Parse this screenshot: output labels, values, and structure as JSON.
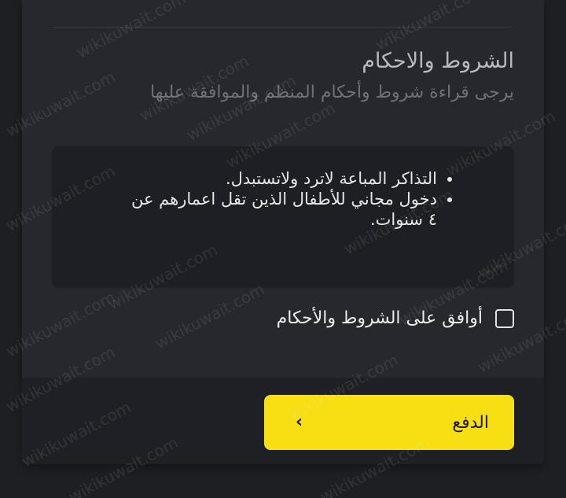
{
  "terms": {
    "title": "الشروط والاحكام",
    "subtitle": "يرجى قراءة شروط وأحكام المنظم والموافقة عليها",
    "items": [
      "التذاكر المباعة لاترد ولاتستبدل.",
      "دخول مجاني للأطفال الذين تقل اعمارهم عن ٤ سنوات."
    ]
  },
  "agreement": {
    "label": "أوافق على الشروط والأحكام",
    "checked": false
  },
  "footer": {
    "pay_label": "الدفع",
    "pay_icon": "chevron-left-icon",
    "pay_color": "#f7df13"
  },
  "watermark": {
    "text": "wikikuwait.com"
  }
}
